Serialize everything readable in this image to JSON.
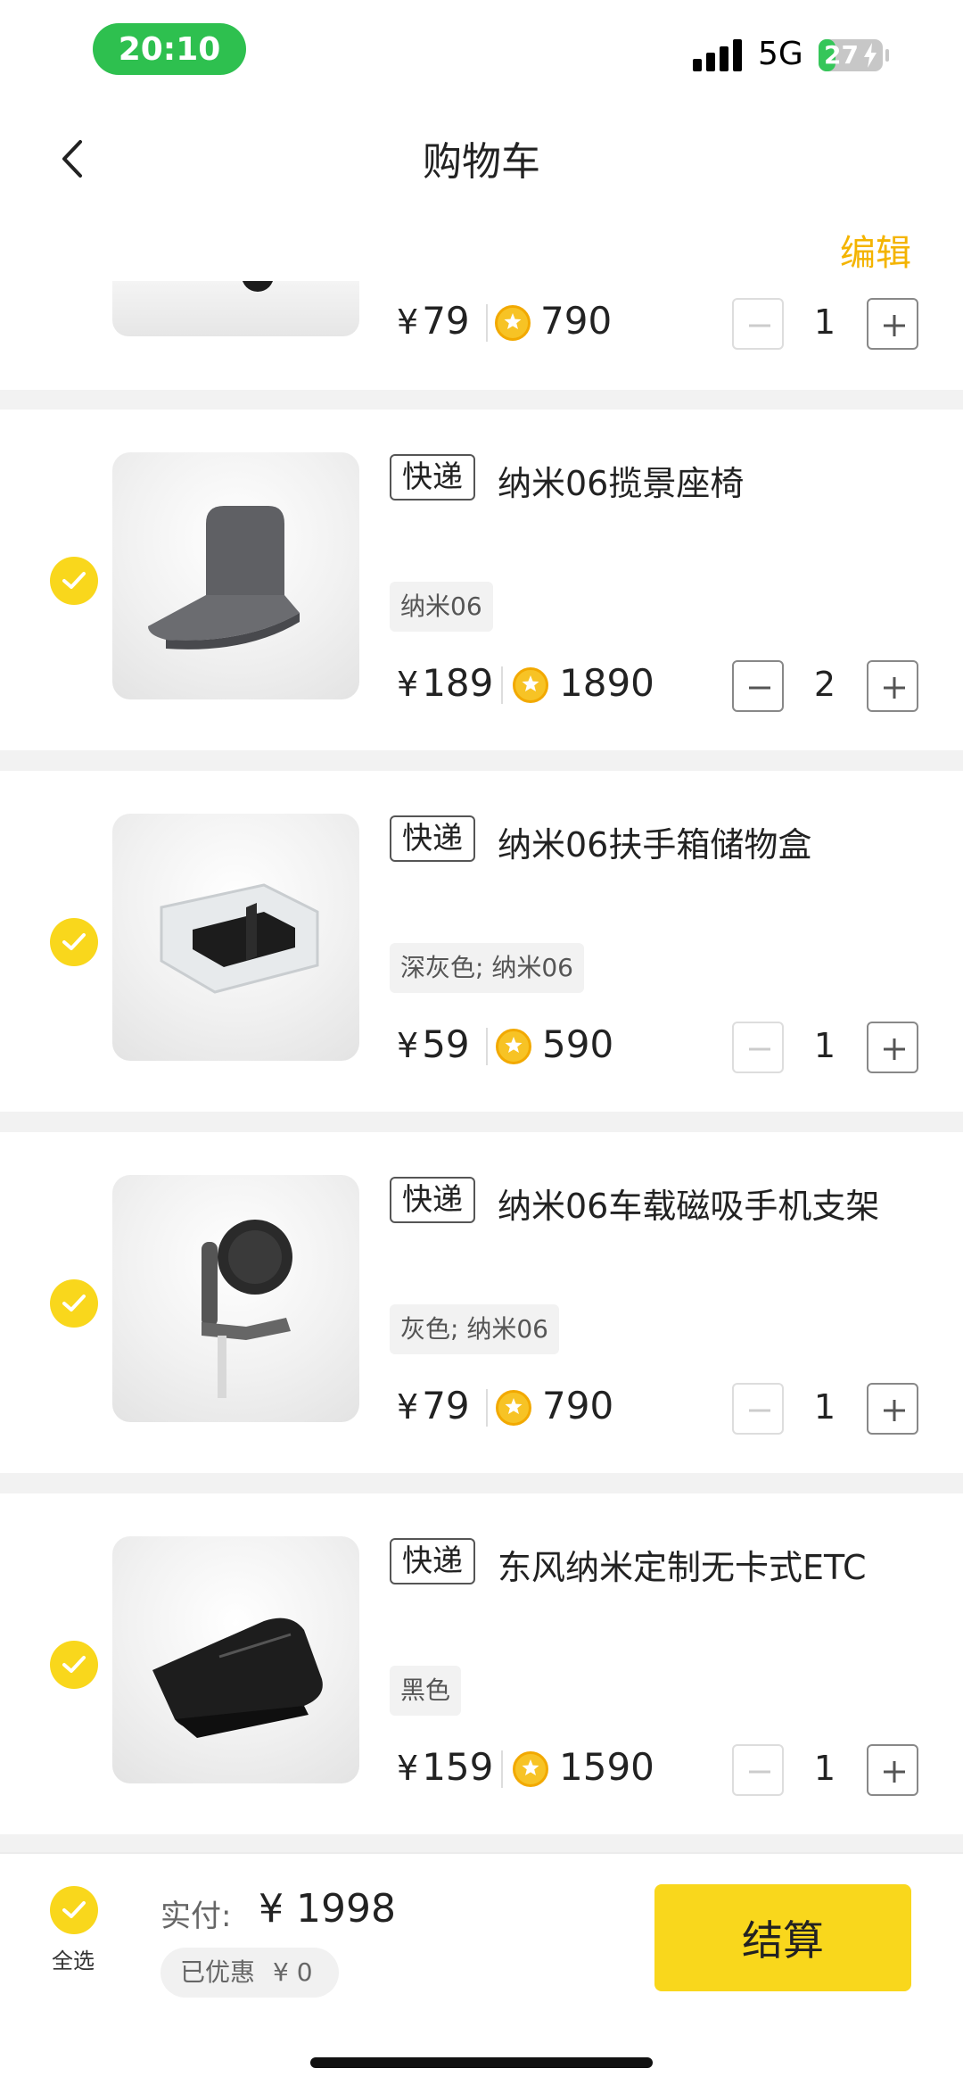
{
  "status_bar": {
    "time": "20:10",
    "network": "5G",
    "battery": "27",
    "battery_level": 0.27,
    "battery_icon": "bolt-icon"
  },
  "nav": {
    "title": "购物车",
    "back_icon": "chevron-left-icon"
  },
  "edit_label": "编辑",
  "partial_item": {
    "price": "79",
    "points": "790",
    "qty": "1"
  },
  "items": [
    {
      "express_tag": "快递",
      "title": "纳米06揽景座椅",
      "spec": "纳米06",
      "price": "189",
      "points": "1890",
      "qty": "2"
    },
    {
      "express_tag": "快递",
      "title": "纳米06扶手箱储物盒",
      "spec": "深灰色; 纳米06",
      "price": "59",
      "points": "590",
      "qty": "1"
    },
    {
      "express_tag": "快递",
      "title": "纳米06车载磁吸手机支架",
      "spec": "灰色; 纳米06",
      "price": "79",
      "points": "790",
      "qty": "1"
    },
    {
      "express_tag": "快递",
      "title": "东风纳米定制无卡式ETC",
      "spec": "黑色",
      "price": "159",
      "points": "1590",
      "qty": "1"
    }
  ],
  "currency": "¥",
  "bottom": {
    "select_all": "全选",
    "total_label": "实付:",
    "total": "¥ 1998",
    "discount_label": "已优惠",
    "discount_value": "¥ 0",
    "checkout": "结算"
  },
  "colors": {
    "accent": "#f9d71c",
    "edit": "#f4b400",
    "time_pill": "#2ec04f"
  }
}
